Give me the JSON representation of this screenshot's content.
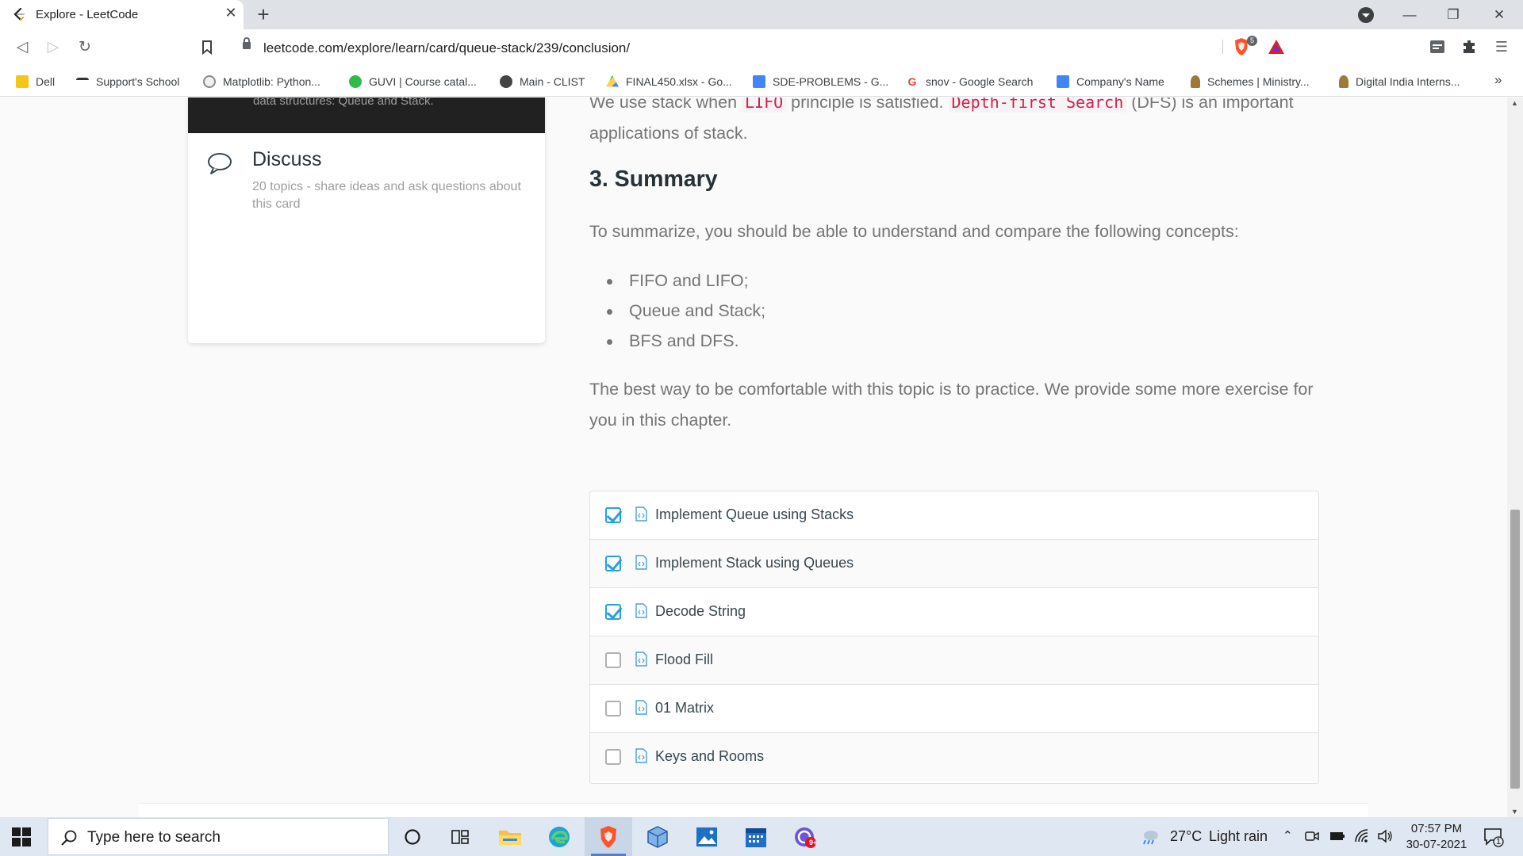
{
  "browser": {
    "tab_title": "Explore - LeetCode",
    "new_tab_symbol": "+",
    "close_symbol": "✕",
    "url": "leetcode.com/explore/learn/card/queue-stack/239/conclusion/",
    "shield_count": "5"
  },
  "bookmarks": [
    {
      "label": "Dell",
      "color": "#f5c518"
    },
    {
      "label": "Support's School",
      "color": "#333333"
    },
    {
      "label": "Matplotlib: Python...",
      "color": "#8a8a8a"
    },
    {
      "label": "GUVI | Course catal...",
      "color": "#2dbb4c"
    },
    {
      "label": "Main - CLIST",
      "color": "#444444"
    },
    {
      "label": "FINAL450.xlsx - Go...",
      "color": "#1fa463"
    },
    {
      "label": "SDE-PROBLEMS - G...",
      "color": "#4285f4"
    },
    {
      "label": "snov - Google Search",
      "color": "#ea4335"
    },
    {
      "label": "Company's Name",
      "color": "#4285f4"
    },
    {
      "label": "Schemes | Ministry...",
      "color": "#a0783c"
    },
    {
      "label": "Digital India Interns...",
      "color": "#a0783c"
    }
  ],
  "bookmarks_more": "»",
  "sidebar": {
    "card_partial_text": "data structures: Queue and Stack.",
    "discuss_title": "Discuss",
    "discuss_subtitle": "20 topics - share ideas and ask questions about this card"
  },
  "article": {
    "para1_a": "We use stack when ",
    "para1_code1": "LIFO",
    "para1_b": " principle is satisfied. ",
    "para1_code2": "Depth-first Search",
    "para1_c": " (DFS) is an important applications of stack.",
    "heading": "3. Summary",
    "para2": "To summarize, you should be able to understand and compare the following concepts:",
    "bullets": [
      "FIFO and LIFO;",
      "Queue and Stack;",
      "BFS and DFS."
    ],
    "para3": "The best way to be comfortable with this topic is to practice. We provide some more exercise for you in this chapter."
  },
  "problems": [
    {
      "name": "Implement Queue using Stacks",
      "completed": true
    },
    {
      "name": "Implement Stack using Queues",
      "completed": true
    },
    {
      "name": "Decode String",
      "completed": true
    },
    {
      "name": "Flood Fill",
      "completed": false
    },
    {
      "name": "01 Matrix",
      "completed": false
    },
    {
      "name": "Keys and Rooms",
      "completed": false
    }
  ],
  "taskbar": {
    "search_placeholder": "Type here to search",
    "weather_temp": "27°C",
    "weather_desc": "Light rain",
    "time": "07:57 PM",
    "date": "30-07-2021",
    "notification_count": "1",
    "mail_badge": "9+"
  }
}
